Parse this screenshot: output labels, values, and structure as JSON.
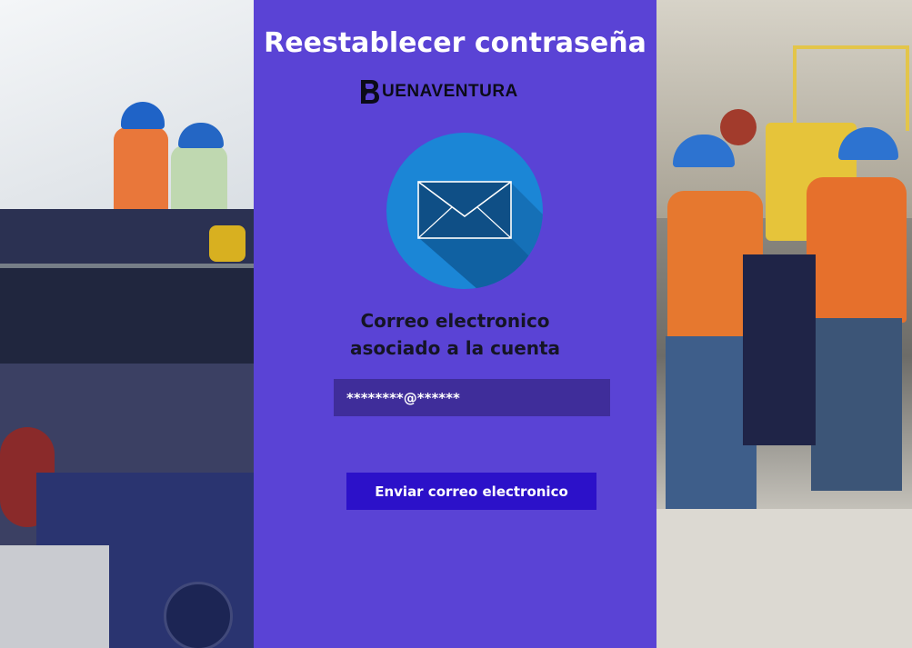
{
  "page": {
    "title": "Reestablecer contraseña",
    "brand_logo_text": "UENAVENTURA",
    "field_label_line1": "Correo electronico",
    "field_label_line2": "asociado a la cuenta",
    "email_value": "********@******",
    "submit_label": "Enviar correo electronico"
  },
  "icons": {
    "logo": "buenaventura-b-logo",
    "mail": "envelope-icon"
  },
  "colors": {
    "panel_background": "#5a43d5",
    "field_background": "#3f2d9a",
    "button_background": "#2c11c9",
    "mail_circle": "#1b86d6"
  }
}
